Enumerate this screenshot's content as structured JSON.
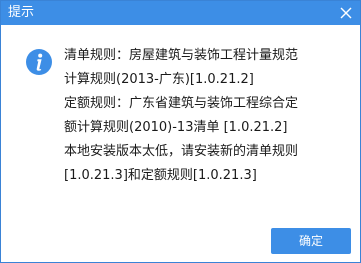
{
  "dialog": {
    "title": "提示",
    "close_icon": "close-icon",
    "info_icon": "info-icon",
    "message_lines": [
      "清单规则：房屋建筑与装饰工程计量规范",
      "计算规则(2013-广东)[1.0.21.2]",
      "定额规则：广东省建筑与装饰工程综合定",
      "额计算规则(2010)-13清单 [1.0.21.2]",
      "本地安装版本太低，请安装新的清单规则",
      "[1.0.21.3]和定额规则[1.0.21.3]"
    ],
    "ok_label": "确定"
  },
  "colors": {
    "title_bar": "#3d8ee6",
    "icon": "#3d8ee6",
    "button": "#3d8ee6",
    "text": "#1a1a1a"
  }
}
